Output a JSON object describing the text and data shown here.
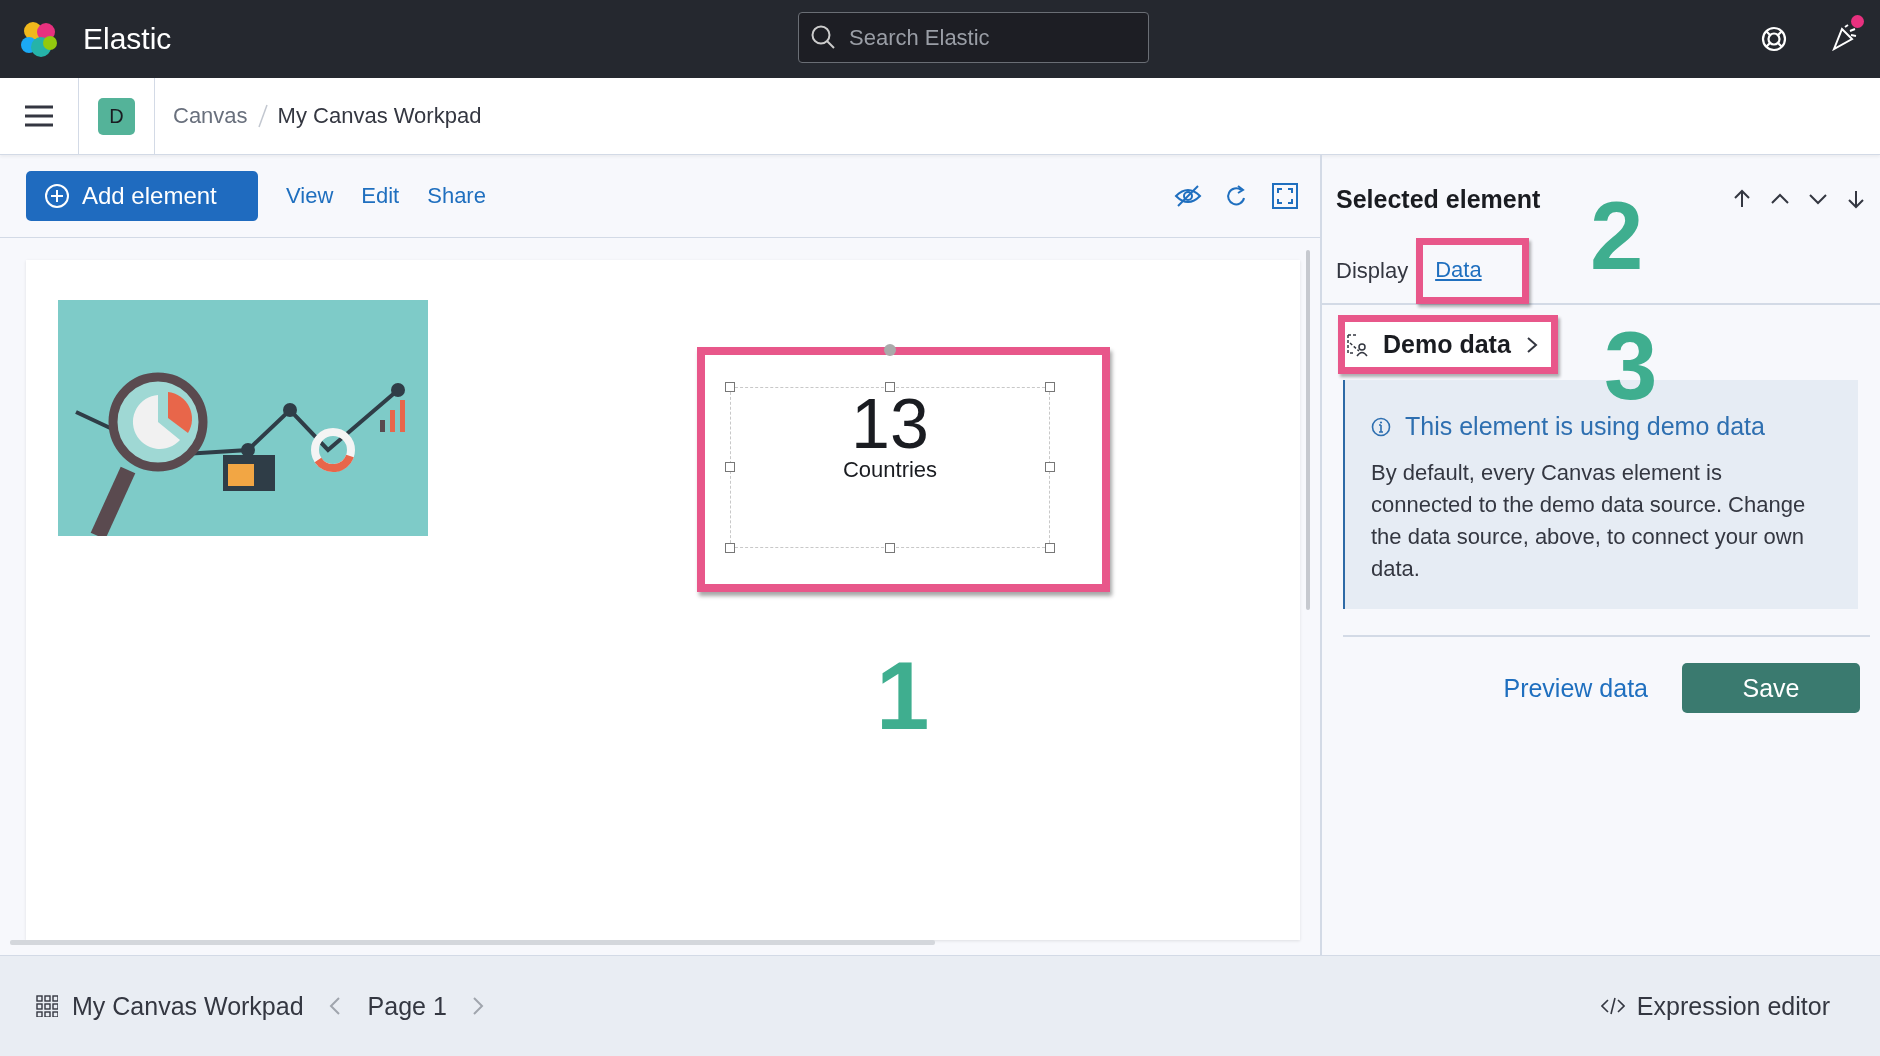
{
  "header": {
    "brand": "Elastic",
    "search": {
      "placeholder": "Search Elastic"
    }
  },
  "breadcrumbs": {
    "space": "D",
    "items": [
      {
        "label": "Canvas"
      },
      {
        "label": "My Canvas Workpad"
      }
    ]
  },
  "toolbar": {
    "add_button": "Add element",
    "menus": [
      "View",
      "Edit",
      "Share"
    ]
  },
  "workpad": {
    "elements": [
      {
        "kind": "picture"
      },
      {
        "kind": "metric",
        "value": "13",
        "label": "Countries",
        "selected": true
      }
    ]
  },
  "sidebar": {
    "title": "Selected element",
    "tabs": [
      {
        "label": "Display",
        "selected": false
      },
      {
        "label": "Data",
        "selected": true
      }
    ],
    "datasource": "Demo data",
    "callout": {
      "title": "This element is using demo data",
      "body": "By default, every Canvas element is connected to the demo data source. Change the data source, above, to connect your own data."
    },
    "actions": {
      "preview": "Preview data",
      "save": "Save"
    }
  },
  "annotations": [
    {
      "label": "1"
    },
    {
      "label": "2"
    },
    {
      "label": "3"
    }
  ],
  "footer": {
    "workpad": "My Canvas Workpad",
    "page": "Page 1",
    "expression_editor": "Expression editor"
  }
}
